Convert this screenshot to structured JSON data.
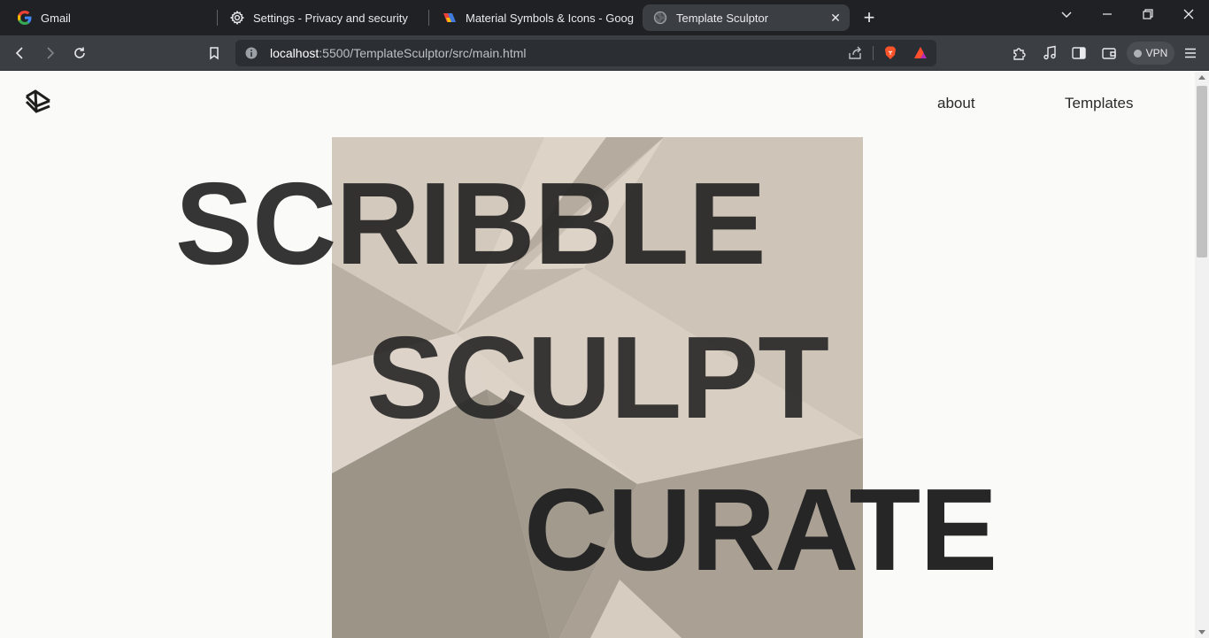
{
  "browser": {
    "tabs": [
      {
        "title": "Gmail",
        "icon": "google-icon",
        "active": false
      },
      {
        "title": "Settings - Privacy and security",
        "icon": "gear-icon",
        "active": false
      },
      {
        "title": "Material Symbols & Icons - Google F",
        "icon": "material-symbols-icon",
        "active": false
      },
      {
        "title": "Template Sculptor",
        "icon": "globe-icon",
        "active": true
      }
    ],
    "address_bar": {
      "host": "localhost",
      "path": ":5500/TemplateSculptor/src/main.html"
    },
    "vpn_label": "VPN",
    "colors": {
      "tabbar": "#202124",
      "toolbar": "#3b3f44",
      "omnibox": "#2b2e32",
      "brave": "#fb542b"
    }
  },
  "page": {
    "nav": {
      "about_label": "about",
      "templates_label": "Templates"
    },
    "hero": {
      "words": [
        "SCRIBBLE",
        "SCULPT",
        "CURATE"
      ]
    },
    "colors": {
      "background": "#fafaf8",
      "text": "#262626",
      "art_light": "#ddd3c7",
      "art_mid": "#b9afa2",
      "art_dark": "#9d9488"
    }
  }
}
